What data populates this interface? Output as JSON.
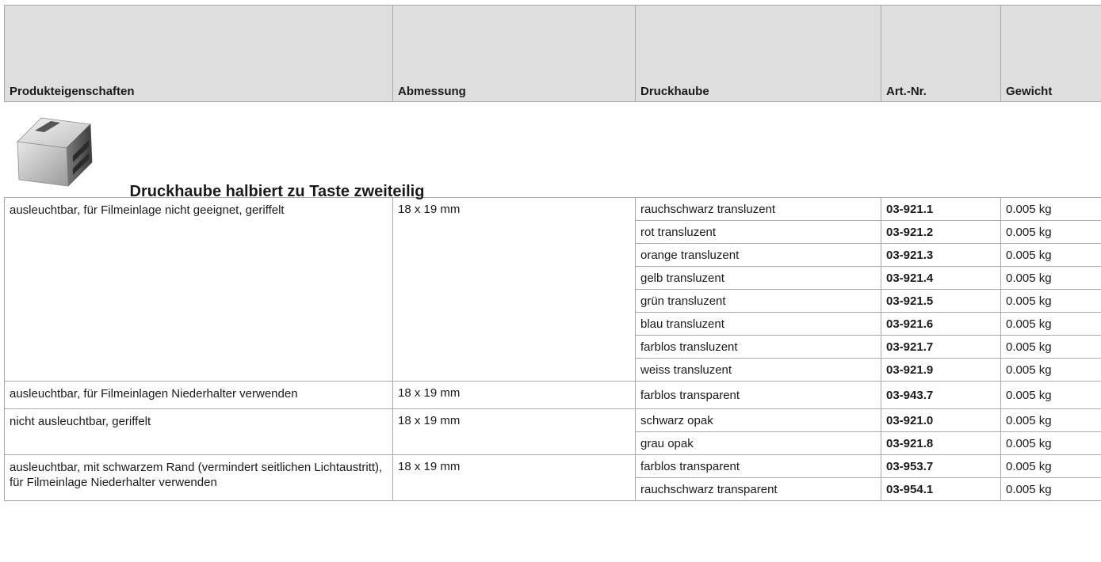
{
  "header": {
    "col_properties": "Produkteigenschaften",
    "col_dimension": "Abmessung",
    "col_cap": "Druckhaube",
    "col_artnr": "Art.-Nr.",
    "col_weight": "Gewicht"
  },
  "section": {
    "title": "Druckhaube halbiert zu Taste zweiteilig",
    "image_icon": "keycap-product-image"
  },
  "groups": [
    {
      "properties": "ausleuchtbar, für Filmeinlage nicht geeignet, geriffelt",
      "dimension": "18 x 19 mm",
      "items": [
        {
          "cap": "rauchschwarz transluzent",
          "artnr": "03-921.1",
          "weight": "0.005 kg"
        },
        {
          "cap": "rot transluzent",
          "artnr": "03-921.2",
          "weight": "0.005 kg"
        },
        {
          "cap": "orange transluzent",
          "artnr": "03-921.3",
          "weight": "0.005 kg"
        },
        {
          "cap": "gelb transluzent",
          "artnr": "03-921.4",
          "weight": "0.005 kg"
        },
        {
          "cap": "grün transluzent",
          "artnr": "03-921.5",
          "weight": "0.005 kg"
        },
        {
          "cap": "blau transluzent",
          "artnr": "03-921.6",
          "weight": "0.005 kg"
        },
        {
          "cap": "farblos transluzent",
          "artnr": "03-921.7",
          "weight": "0.005 kg"
        },
        {
          "cap": "weiss transluzent",
          "artnr": "03-921.9",
          "weight": "0.005 kg"
        }
      ]
    },
    {
      "properties": "ausleuchtbar, für Filmeinlagen Niederhalter verwenden",
      "dimension": "18 x 19 mm",
      "items": [
        {
          "cap": "farblos transparent",
          "artnr": "03-943.7",
          "weight": "0.005 kg"
        }
      ]
    },
    {
      "properties": "nicht ausleuchtbar, geriffelt",
      "dimension": "18 x 19 mm",
      "items": [
        {
          "cap": "schwarz opak",
          "artnr": "03-921.0",
          "weight": "0.005 kg"
        },
        {
          "cap": "grau opak",
          "artnr": "03-921.8",
          "weight": "0.005 kg"
        }
      ]
    },
    {
      "properties": "ausleuchtbar, mit schwarzem Rand (vermindert seitlichen Lichtaustritt), für Filmeinlage Niederhalter verwenden",
      "dimension": "18 x 19 mm",
      "items": [
        {
          "cap": "farblos transparent",
          "artnr": "03-953.7",
          "weight": "0.005 kg"
        },
        {
          "cap": "rauchschwarz transparent",
          "artnr": "03-954.1",
          "weight": "0.005 kg"
        }
      ]
    }
  ],
  "colors": {
    "header_bg": "#dedede",
    "border": "#a8a8a8",
    "text": "#1a1a1a"
  }
}
